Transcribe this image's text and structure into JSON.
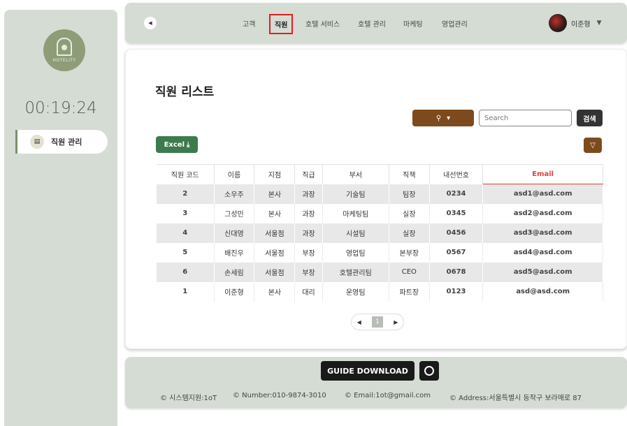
{
  "sidebar": {
    "logo_text": "HOTELITY",
    "clock": "00:19:24",
    "items": [
      {
        "label": "직원 관리",
        "icon": "id-card-icon"
      }
    ]
  },
  "topbar": {
    "back_icon": "chevron-left-icon",
    "nav": [
      "고객",
      "직원",
      "호텔 서비스",
      "호텔 관리",
      "마케팅",
      "영업관리"
    ],
    "active_nav": "직원",
    "user_name": "이준형",
    "caret": "▼"
  },
  "main": {
    "title": "직원 리스트",
    "search": {
      "toggle_icon": "search-icon",
      "placeholder": "Search",
      "button_label": "검색"
    },
    "excel_label": "Excel",
    "filter_icon": "filter-icon",
    "table": {
      "headers": [
        "직원 코드",
        "이름",
        "지점",
        "직급",
        "부서",
        "직책",
        "내선번호",
        "Email"
      ],
      "rows": [
        [
          "2",
          "소우주",
          "본사",
          "과장",
          "기술팀",
          "팀장",
          "0234",
          "asd1@asd.com"
        ],
        [
          "3",
          "그성민",
          "본사",
          "과장",
          "마케팅팀",
          "실장",
          "0345",
          "asd2@asd.com"
        ],
        [
          "4",
          "신대영",
          "서울점",
          "과장",
          "시설팀",
          "실장",
          "0456",
          "asd3@asd.com"
        ],
        [
          "5",
          "배진우",
          "서울점",
          "부장",
          "영업팀",
          "본부장",
          "0567",
          "asd4@asd.com"
        ],
        [
          "6",
          "손세림",
          "서울점",
          "부장",
          "호텔관리팀",
          "CEO",
          "0678",
          "asd5@asd.com"
        ],
        [
          "1",
          "이준형",
          "본사",
          "대리",
          "운영팀",
          "파트장",
          "0123",
          "asd@asd.com"
        ]
      ]
    },
    "pagination": {
      "prev": "◀",
      "current": "1",
      "next": "▶"
    }
  },
  "footer": {
    "guide_label": "GUIDE DOWNLOAD",
    "github_icon": "github-icon",
    "info": [
      "© 시스템지원:1oT",
      "© Number:010-9874-3010",
      "© Email:1ot@gmail.com",
      "© Address:서울특별시 동작구 보라매로 87"
    ]
  },
  "colors": {
    "accent_brown": "#7d4a1e",
    "excel_green": "#3d7a4e",
    "panel": "#d5dcd4",
    "active_border": "#e02020"
  }
}
